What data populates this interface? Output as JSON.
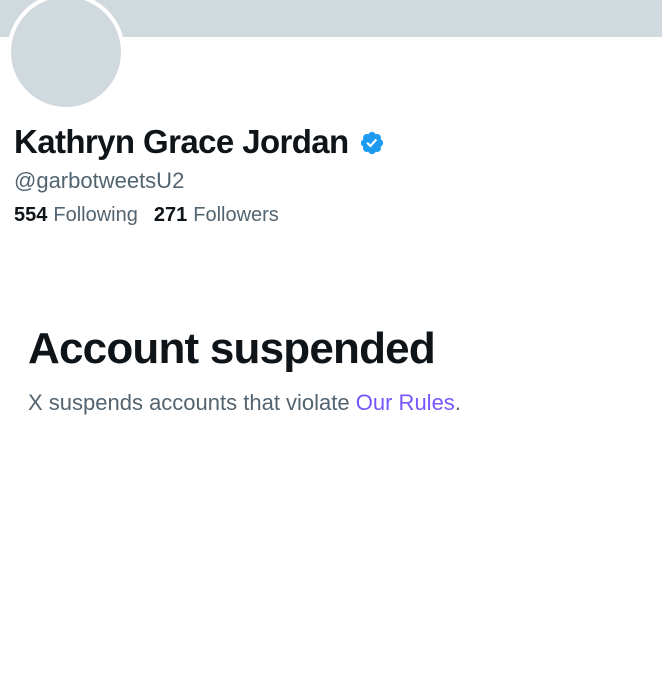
{
  "profile": {
    "display_name": "Kathryn Grace Jordan",
    "handle": "@garbotweetsU2",
    "verified": true,
    "verified_icon": "verified-badge-icon",
    "following_count": "554",
    "following_label": "Following",
    "followers_count": "271",
    "followers_label": "Followers"
  },
  "suspension": {
    "title": "Account suspended",
    "message_prefix": "X suspends accounts that violate ",
    "rules_link": "Our Rules",
    "message_suffix": "."
  },
  "colors": {
    "banner": "#cfd9de",
    "avatar_placeholder": "#cfd9de",
    "verified_blue": "#1d9bf0",
    "link_purple": "#7856ff",
    "primary_text": "#0f1419",
    "secondary_text": "#536471"
  }
}
